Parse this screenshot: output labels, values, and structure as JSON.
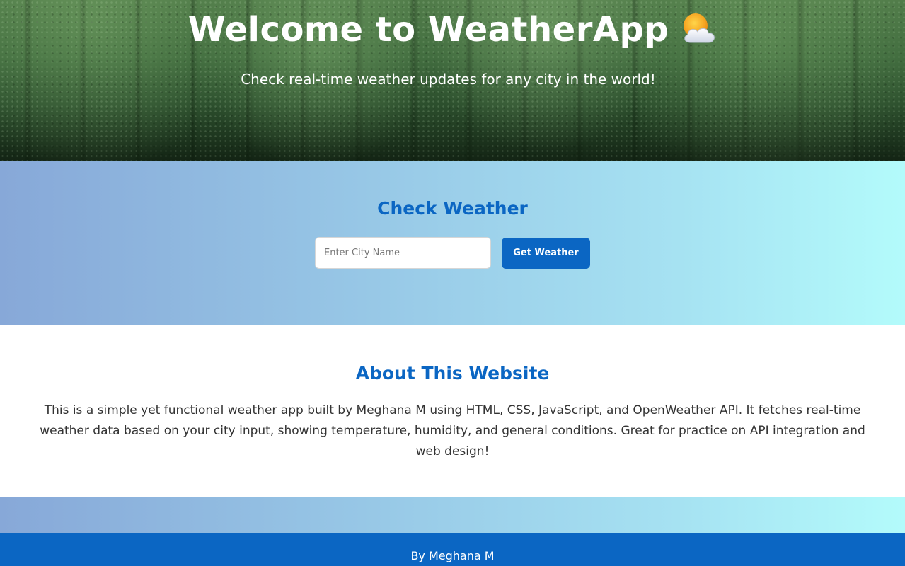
{
  "hero": {
    "title": "Welcome to WeatherApp",
    "icon": "sun-behind-cloud-icon",
    "subtitle": "Check real-time weather updates for any city in the world!"
  },
  "weather_section": {
    "title": "Check Weather",
    "city_input": {
      "placeholder": "Enter City Name",
      "value": ""
    },
    "button_label": "Get Weather"
  },
  "about": {
    "title": "About This Website",
    "text": "This is a simple yet functional weather app built by Meghana M using HTML, CSS, JavaScript, and OpenWeather API. It fetches real-time weather data based on your city input, showing temperature, humidity, and general conditions. Great for practice on API integration and web design!"
  },
  "footer": {
    "text": "By Meghana M"
  },
  "colors": {
    "accent": "#0b66c3",
    "gradient_start": "#87a8d8",
    "gradient_end": "#b3fbfb",
    "text_dark": "#333333"
  }
}
